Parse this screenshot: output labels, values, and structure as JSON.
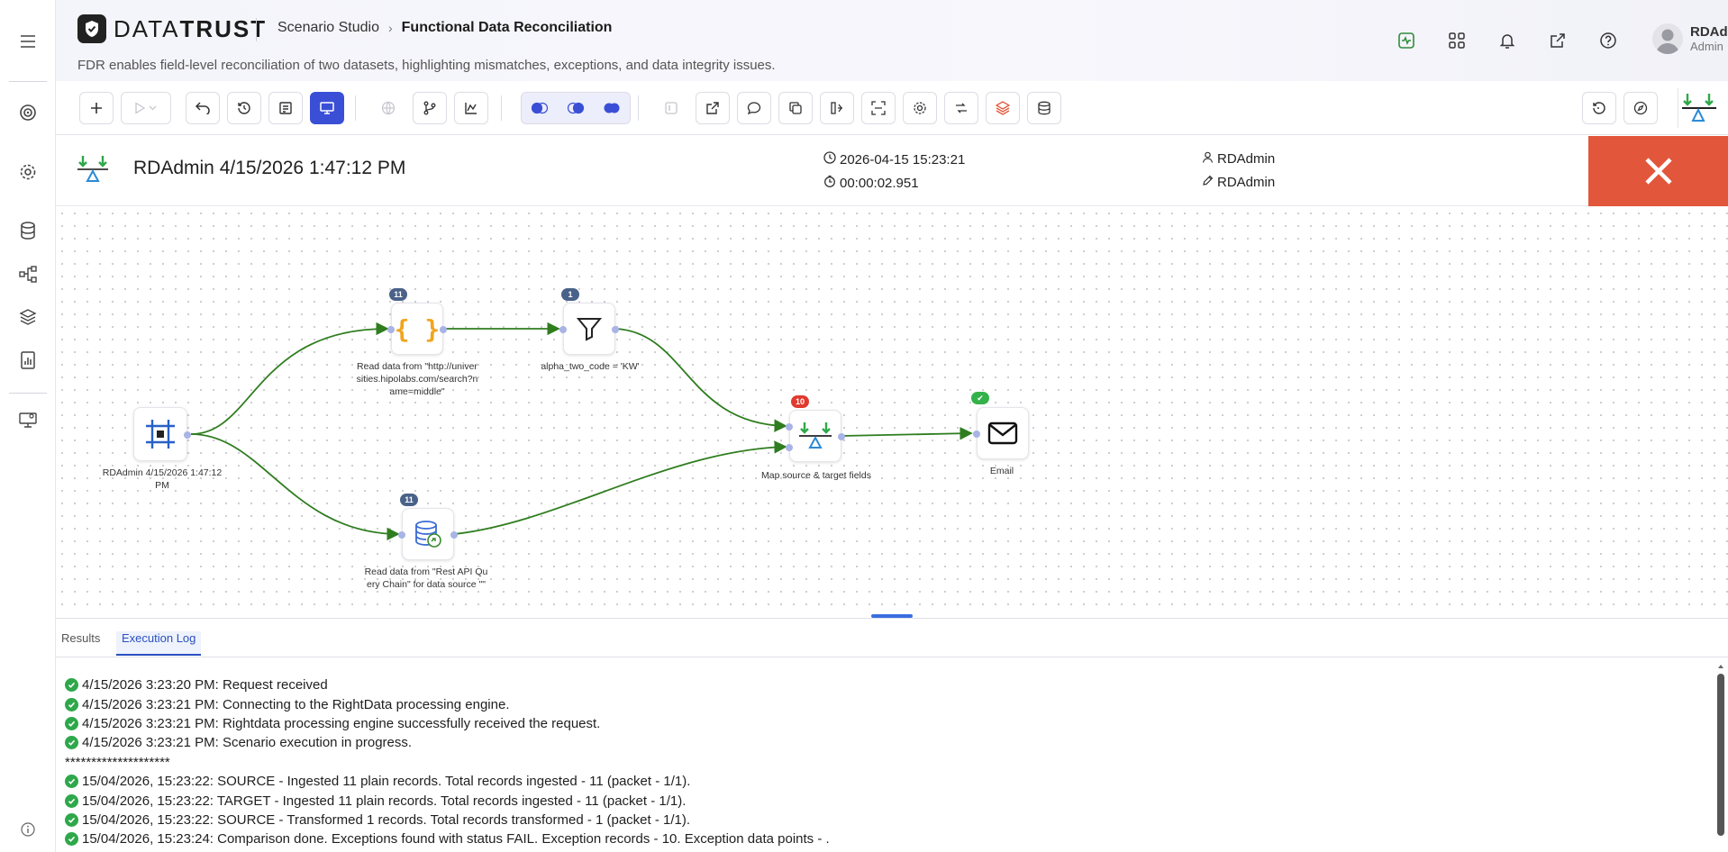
{
  "app": {
    "brand": "DATATRUST",
    "breadcrumb": [
      "Scenario Studio",
      "Functional Data Reconciliation"
    ],
    "subtitle": "FDR enables field-level reconciliation of two datasets, highlighting mismatches, exceptions, and data integrity issues."
  },
  "user": {
    "name": "RDAdmin",
    "role": "Admin"
  },
  "left_rail": {
    "items": [
      "menu-icon",
      "target-icon",
      "gear-icon",
      "database-icon",
      "share-nodes-icon",
      "layers-icon",
      "report-icon",
      "monitor-icon",
      "info-icon"
    ]
  },
  "run": {
    "title": "RDAdmin 4/15/2026 1:47:12 PM",
    "start_time": "2026-04-15 15:23:21",
    "duration": "00:00:02.951",
    "created_by": "RDAdmin",
    "modified_by": "RDAdmin"
  },
  "flow": {
    "nodes": [
      {
        "id": "start",
        "label": "RDAdmin 4/15/2026 1:47:12 PM",
        "icon": "frame-icon"
      },
      {
        "id": "json-read",
        "label": "Read data from \"http://universities.hipolabs.com/search?name=middle\"",
        "badge": "11",
        "icon": "braces-icon"
      },
      {
        "id": "filter",
        "label": "alpha_two_code = 'KW'",
        "badge": "1",
        "icon": "filter-icon"
      },
      {
        "id": "db-read",
        "label": "Read data from \"Rest API Query Chain\" for data source \"\"",
        "badge": "11",
        "icon": "database-link-icon"
      },
      {
        "id": "map",
        "label": "Map source & target fields",
        "badge": "10",
        "icon": "scale-icon"
      },
      {
        "id": "email",
        "label": "Email",
        "badge": "✔",
        "icon": "envelope-icon"
      }
    ]
  },
  "panel": {
    "tabs": [
      "Results",
      "Execution Log"
    ],
    "active_tab": "Execution Log",
    "log": [
      {
        "ok": true,
        "text": "4/15/2026 3:23:20 PM: Request received"
      },
      {
        "ok": true,
        "text": "4/15/2026 3:23:21 PM: Connecting to the RightData processing engine."
      },
      {
        "ok": true,
        "text": "4/15/2026 3:23:21 PM: Rightdata processing engine successfully received the request."
      },
      {
        "ok": true,
        "text": "4/15/2026 3:23:21 PM: Scenario execution in progress."
      },
      {
        "ok": false,
        "text": "********************"
      },
      {
        "ok": true,
        "text": "15/04/2026, 15:23:22: SOURCE - Ingested 11 plain records. Total records ingested - 11 (packet - 1/1)."
      },
      {
        "ok": true,
        "text": "15/04/2026, 15:23:22: TARGET - Ingested 11 plain records. Total records ingested - 11 (packet - 1/1)."
      },
      {
        "ok": true,
        "text": "15/04/2026, 15:23:22: SOURCE - Transformed 1 records. Total records transformed - 1 (packet - 1/1)."
      },
      {
        "ok": true,
        "text": "15/04/2026, 15:23:24: Comparison done. Exceptions found with status FAIL. Exception records - 10. Exception data points - ."
      }
    ]
  },
  "colors": {
    "accent": "#3a4fd6",
    "close": "#e2573b",
    "edge": "#2f7d1f",
    "ok": "#2ea84a",
    "badge_alert": "#e03a2f"
  }
}
